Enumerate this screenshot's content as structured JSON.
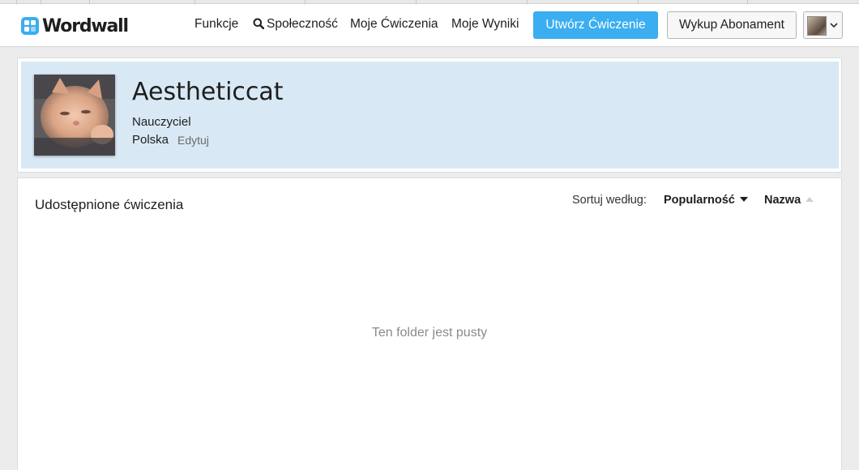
{
  "brand": {
    "name": "Wordwall",
    "accent": "#3aaef0"
  },
  "nav": {
    "features": "Funkcje",
    "community": "Społeczność",
    "my_activities": "Moje Ćwiczenia",
    "my_results": "Moje Wyniki",
    "create_button": "Utwórz Ćwiczenie",
    "subscribe_button": "Wykup Abonament"
  },
  "profile": {
    "name": "Aestheticcat",
    "role": "Nauczyciel",
    "country": "Polska",
    "edit_link": "Edytuj",
    "background_color": "#d8e9f5"
  },
  "shared": {
    "title": "Udostępnione ćwiczenia",
    "sort_label": "Sortuj według:",
    "sort_options": [
      "Popularność",
      "Nazwa"
    ],
    "selected_sort": "Popularność",
    "empty_message": "Ten folder jest pusty"
  }
}
